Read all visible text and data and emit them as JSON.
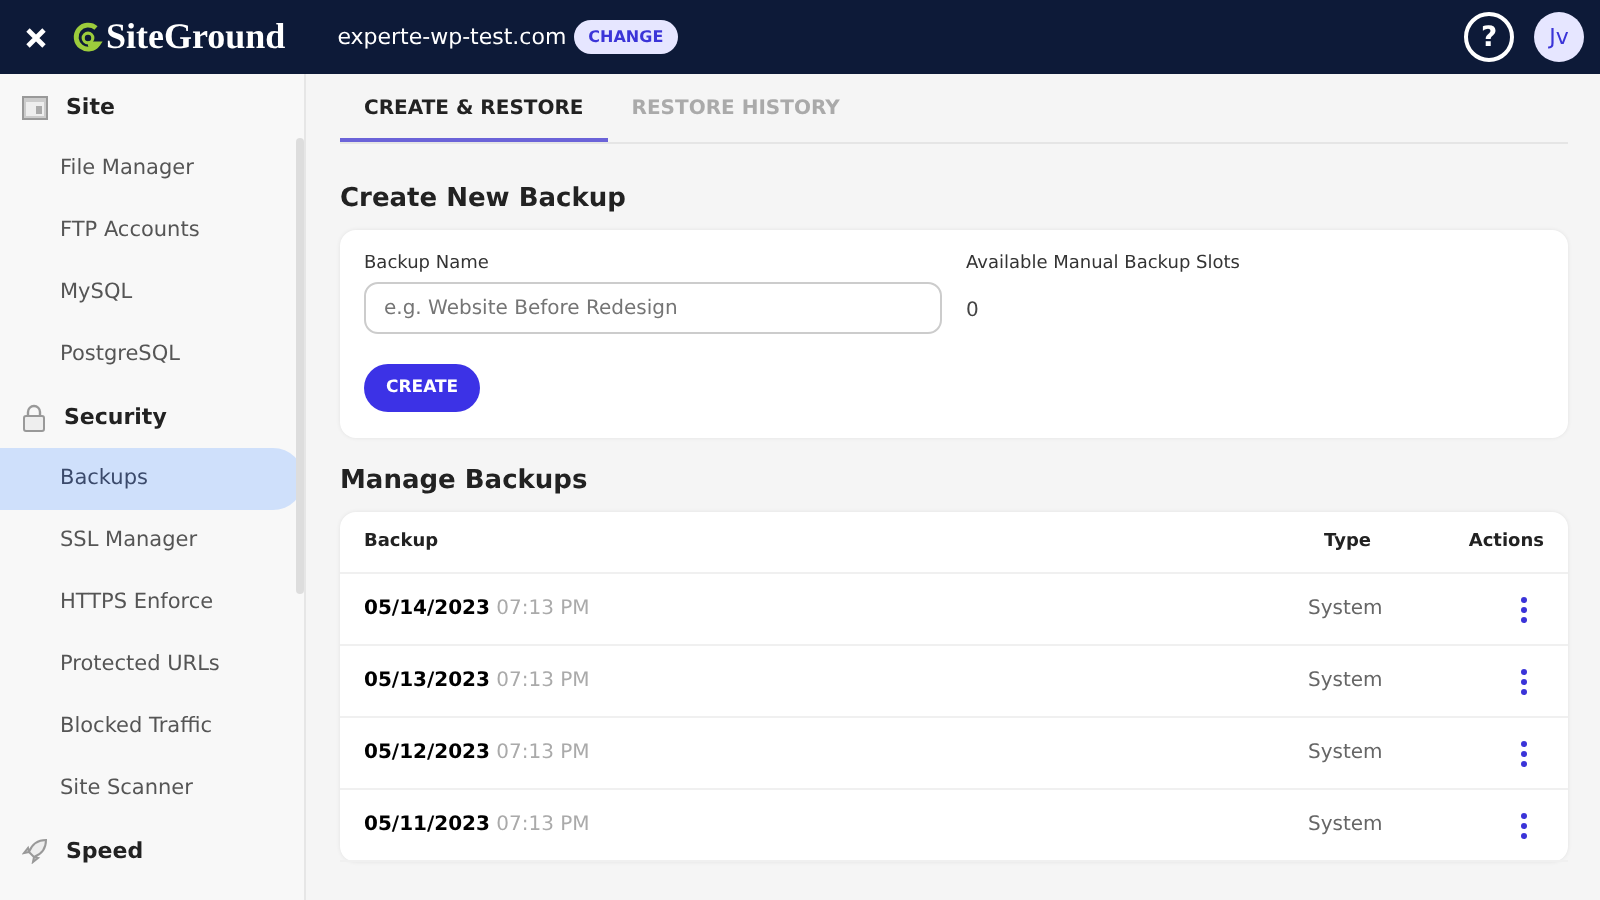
{
  "topbar": {
    "logo": "SiteGround",
    "site": "experte-wp-test.com",
    "change_button": "CHANGE",
    "help": "?",
    "avatar": "Jv"
  },
  "sidebar": {
    "groups": [
      {
        "kind": "site",
        "label": "Site",
        "items": [
          {
            "label": "File Manager",
            "selected": false
          },
          {
            "label": "FTP Accounts",
            "selected": false
          },
          {
            "label": "MySQL",
            "selected": false
          },
          {
            "label": "PostgreSQL",
            "selected": false
          }
        ]
      },
      {
        "kind": "security",
        "label": "Security",
        "items": [
          {
            "label": "Backups",
            "selected": true
          },
          {
            "label": "SSL Manager",
            "selected": false
          },
          {
            "label": "HTTPS Enforce",
            "selected": false
          },
          {
            "label": "Protected URLs",
            "selected": false
          },
          {
            "label": "Blocked Traffic",
            "selected": false
          },
          {
            "label": "Site Scanner",
            "selected": false
          }
        ]
      },
      {
        "kind": "speed",
        "label": "Speed"
      }
    ]
  },
  "tabs": [
    {
      "label": "CREATE & RESTORE",
      "selected": true
    },
    {
      "label": "RESTORE HISTORY",
      "selected": false
    }
  ],
  "create": {
    "title": "Create New Backup",
    "name_label": "Backup Name",
    "placeholder": "e.g. Website Before Redesign",
    "slots_label": "Available Manual Backup Slots",
    "slots_value": "0",
    "button": "CREATE"
  },
  "manage": {
    "title": "Manage Backups",
    "columns": [
      "Backup",
      "Type",
      "Actions"
    ],
    "rows": [
      {
        "date": "05/14/2023",
        "time": "07:13 PM",
        "type": "System"
      },
      {
        "date": "05/13/2023",
        "time": "07:13 PM",
        "type": "System"
      },
      {
        "date": "05/12/2023",
        "time": "07:13 PM",
        "type": "System"
      },
      {
        "date": "05/11/2023",
        "time": "07:13 PM",
        "type": "System"
      }
    ]
  }
}
